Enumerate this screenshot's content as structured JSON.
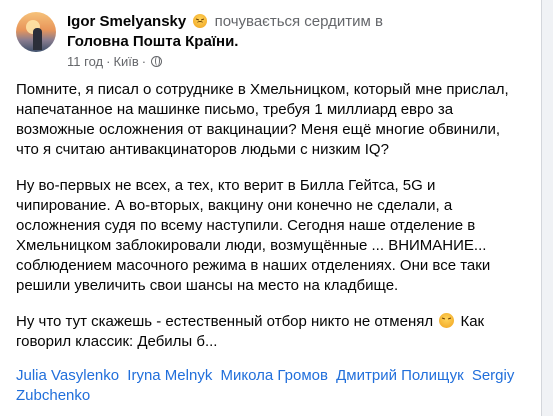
{
  "post": {
    "author": "Igor Smelyansky",
    "feeling": "почувається сердитим в",
    "place": "Головна Пошта Країни",
    "place_suffix": ".",
    "time": "11 год",
    "location": "Київ",
    "separator": "·",
    "paragraphs": [
      "Помните, я писал о сотруднике в Хмельницком, который мне прислал, напечатанное на машинке письмо, требуя 1 миллиард евро за возможные осложнения от вакцинации? Меня ещё многие обвинили, что я считаю антивакцинаторов людьми с низким IQ?",
      "Ну во-первых не всех, а тех, кто верит в Билла Гейтса, 5G и чипирование. А во-вторых, вакцину они конечно не сделали, а осложнения судя по всему наступили. Сегодня наше отделение в Хмельницком заблокировали люди, возмущённые ... ВНИМАНИЕ... соблюдением масочного режима в наших отделениях. Они все таки решили увеличить свои шансы на место на кладбище."
    ],
    "last_paragraph_part1": "Ну что тут скажешь - естественный отбор никто не отменял",
    "last_paragraph_part2": "Как говорил классик: Дебилы б...",
    "tags": [
      "Julia Vasylenko",
      "Iryna Melnyk",
      "Микола Громов",
      "Дмитрий Полищук",
      "Sergiy Zubchenko"
    ]
  },
  "icons": {
    "feeling": "angry-face-icon",
    "privacy": "globe-icon",
    "menu": "more-options-icon"
  },
  "colors": {
    "link": "#216fdb",
    "secondary_text": "#65676b",
    "background": "#e4e6e9"
  }
}
